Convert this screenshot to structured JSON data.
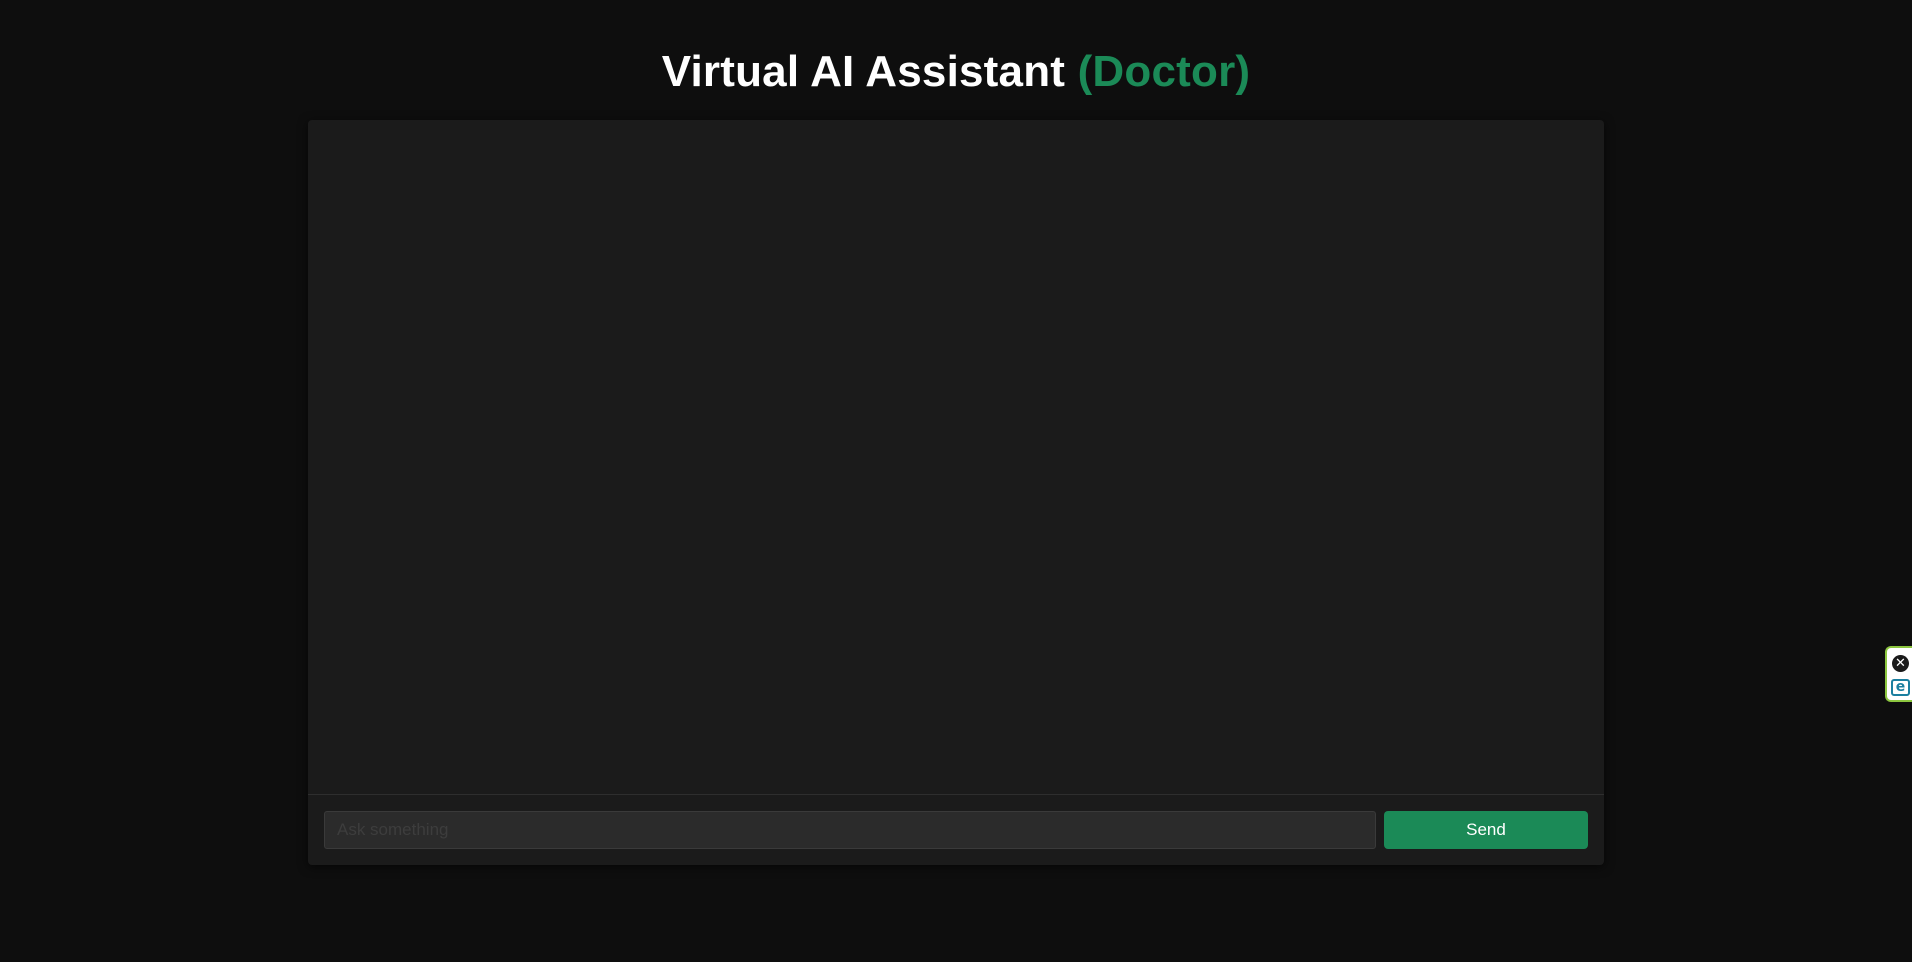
{
  "header": {
    "title_main": "Virtual AI Assistant ",
    "title_accent": "(Doctor)"
  },
  "chat": {
    "messages": [],
    "input": {
      "value": "",
      "placeholder": "Ask something"
    },
    "send_label": "Send"
  },
  "extension_widget": {
    "close_icon": "close-icon",
    "logo_icon": "e-logo-icon",
    "close_glyph": "✕",
    "logo_glyph": "e"
  },
  "colors": {
    "background": "#0e0e0e",
    "panel": "#1b1b1b",
    "accent": "#1b8a57",
    "title_text": "#ffffff"
  }
}
